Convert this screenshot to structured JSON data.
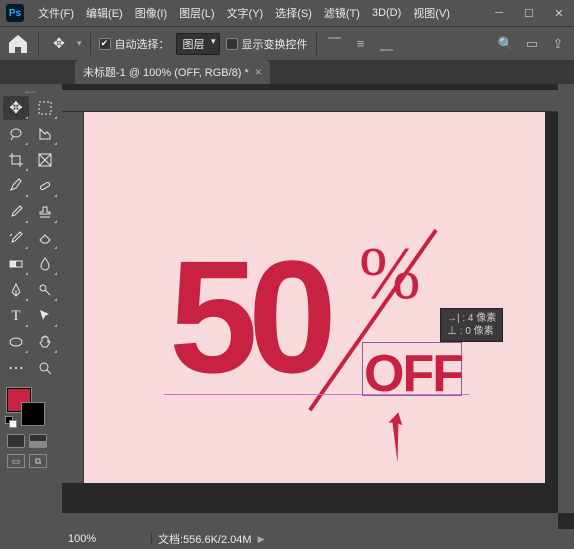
{
  "app": {
    "icon_label": "Ps"
  },
  "menu": {
    "items": [
      "文件(F)",
      "编辑(E)",
      "图像(I)",
      "图层(L)",
      "文字(Y)",
      "选择(S)",
      "滤镜(T)",
      "3D(D)",
      "视图(V)"
    ]
  },
  "options": {
    "auto_select_label": "自动选择：",
    "target_dropdown": "图层",
    "show_transform_label": "显示变换控件"
  },
  "tab": {
    "title": "未标题-1 @ 100% (OFF, RGB/8) *"
  },
  "canvas": {
    "text_50": "50",
    "text_percent": "%",
    "text_off": "OFF"
  },
  "colors": {
    "foreground": "#c72242",
    "background": "#000000",
    "canvas_bg": "#f8dadc"
  },
  "tooltip": {
    "line1": "→| : 4 像素",
    "line2": "⊥ : 0 像素"
  },
  "status": {
    "zoom": "100%",
    "doc_label": "文档:",
    "doc_size": "556.6K/2.04M"
  }
}
